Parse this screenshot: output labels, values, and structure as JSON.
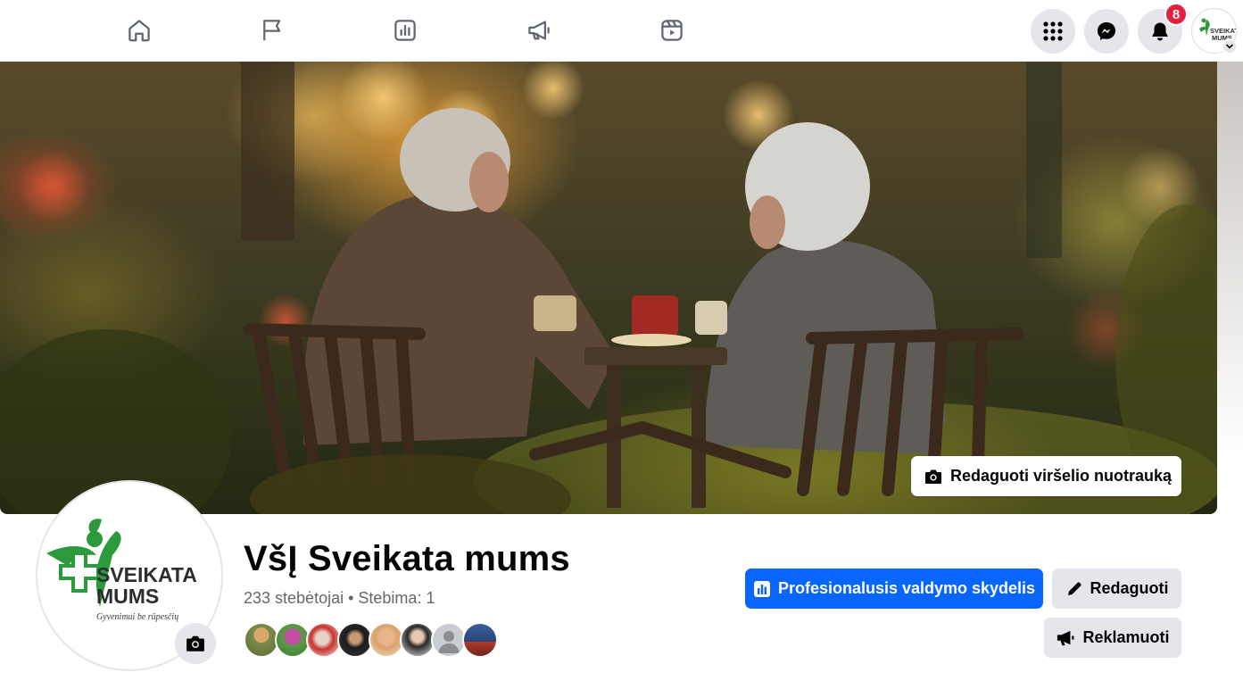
{
  "nav": {
    "tabs": [
      {
        "name": "home",
        "icon": "home-icon"
      },
      {
        "name": "pages",
        "icon": "flag-icon"
      },
      {
        "name": "insights",
        "icon": "insights-icon"
      },
      {
        "name": "ad-center",
        "icon": "megaphone-icon"
      },
      {
        "name": "reels",
        "icon": "reels-icon"
      }
    ],
    "notifications_count": "8"
  },
  "cover": {
    "edit_label": "Redaguoti viršelio nuotrauką"
  },
  "page": {
    "logo_line1": "SVEIKATA",
    "logo_line2": "MUMS",
    "logo_tagline": "Gyvenimui be rūpesčių",
    "title": "VšĮ Sveikata mums",
    "followers_text": "233 stebėtojai",
    "separator": " • ",
    "following_text": "Stebima: 1"
  },
  "actions": {
    "dashboard_label": "Profesionalusis valdymo skydelis",
    "edit_label": "Redaguoti",
    "promote_label": "Reklamuoti"
  },
  "colors": {
    "primary": "#0866ff",
    "secondary_bg": "#e4e6eb",
    "badge": "#e41e3f",
    "logo_green": "#2b9a3a"
  }
}
